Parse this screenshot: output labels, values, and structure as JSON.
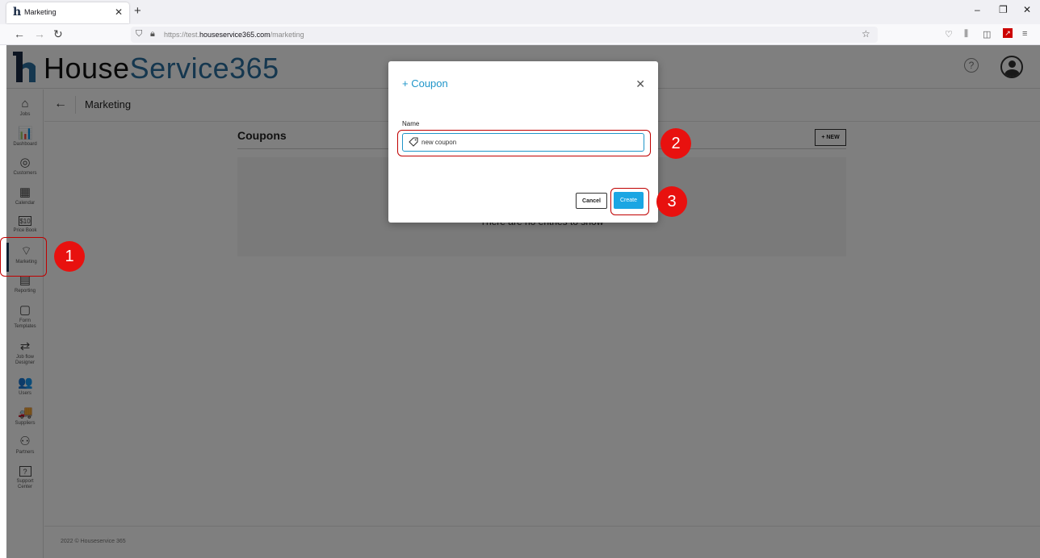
{
  "browser": {
    "tab_title": "Marketing",
    "tab_close": "✕",
    "new_tab": "+",
    "url_prefix": "https://test.",
    "url_domain": "houseservice365.com",
    "url_path": "/marketing",
    "window_controls": [
      "–",
      "❐",
      "✕"
    ]
  },
  "app": {
    "logo_house": "House",
    "logo_service": "Service365",
    "help": "?",
    "sidebar": [
      {
        "label": "Jobs",
        "icon": "jobs-icon",
        "glyph": "⌂"
      },
      {
        "label": "Dashboard",
        "icon": "dashboard-icon",
        "glyph": "📊"
      },
      {
        "label": "Customers",
        "icon": "customers-icon",
        "glyph": "◎"
      },
      {
        "label": "Calendar",
        "icon": "calendar-icon",
        "glyph": "▦"
      },
      {
        "label": "Price Book",
        "icon": "price-book-icon",
        "glyph": "$10"
      },
      {
        "label": "Marketing",
        "icon": "tag-icon",
        "glyph": "⌔"
      },
      {
        "label": "Reporting",
        "icon": "reporting-icon",
        "glyph": "▤"
      },
      {
        "label": "Form Templates",
        "icon": "form-templates-icon",
        "glyph": "▢"
      },
      {
        "label": "Job flow Designer",
        "icon": "job-flow-designer-icon",
        "glyph": "⇄"
      },
      {
        "label": "Users",
        "icon": "users-icon",
        "glyph": "👥"
      },
      {
        "label": "Suppliers",
        "icon": "suppliers-icon",
        "glyph": "🚚"
      },
      {
        "label": "Partners",
        "icon": "partners-icon",
        "glyph": "⚇"
      },
      {
        "label": "Support Center",
        "icon": "support-center-icon",
        "glyph": "?"
      }
    ],
    "page_title": "Marketing",
    "section_title": "Coupons",
    "new_button": "+ NEW",
    "empty_text": "There are no entries to show",
    "footer": "2022 © Houseservice 365"
  },
  "modal": {
    "title": "+ Coupon",
    "close": "✕",
    "name_label": "Name",
    "name_value": "new coupon",
    "cancel_label": "Cancel",
    "create_label": "Create"
  },
  "annotations": {
    "step1": "1",
    "step2": "2",
    "step3": "3",
    "color": "#e8110f"
  }
}
